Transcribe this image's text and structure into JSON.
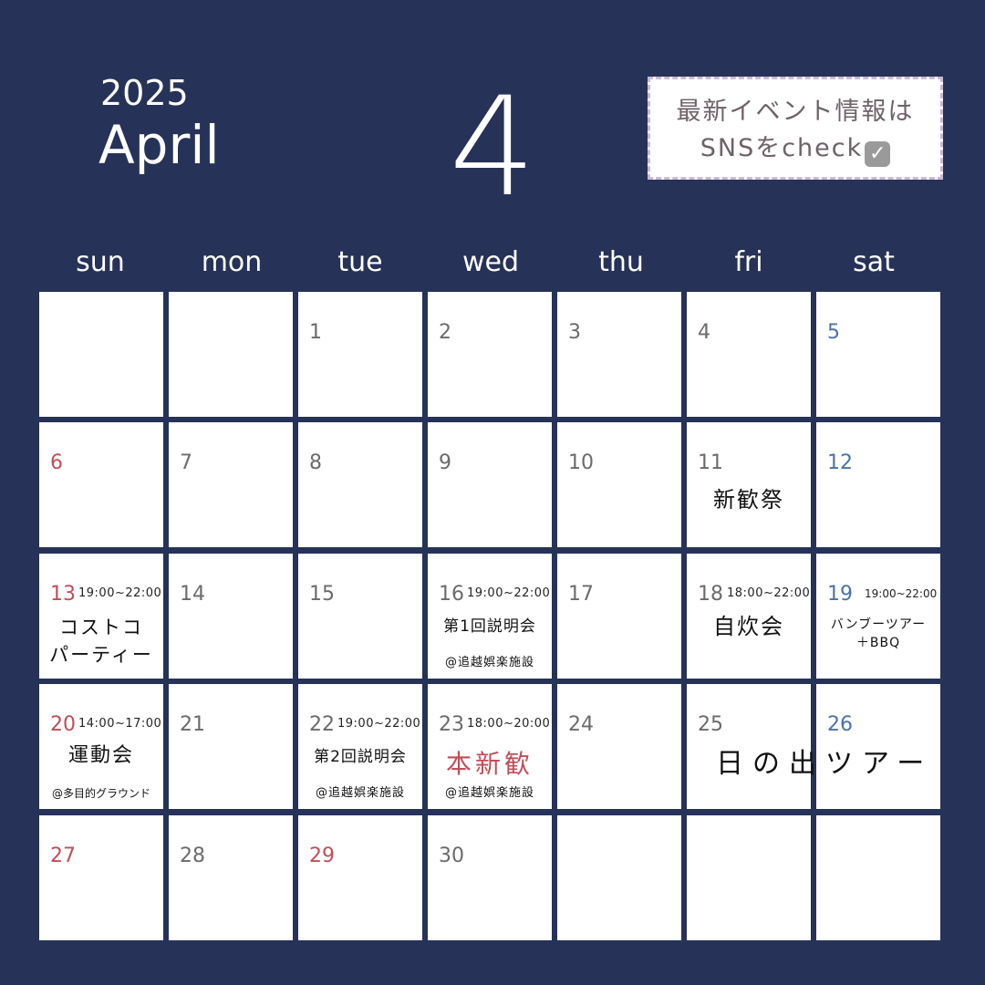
{
  "header": {
    "year": "2025",
    "month_name": "April",
    "month_number": "4",
    "sns_line1": "最新イベント情報は",
    "sns_line2": "SNSをcheck",
    "sns_icon": "checkbox-icon"
  },
  "weekdays": [
    "sun",
    "mon",
    "tue",
    "wed",
    "thu",
    "fri",
    "sat"
  ],
  "days": {
    "d1": "1",
    "d2": "2",
    "d3": "3",
    "d4": "4",
    "d5": "5",
    "d6": "6",
    "d7": "7",
    "d8": "8",
    "d9": "9",
    "d10": "10",
    "d11": "11",
    "d12": "12",
    "d13": "13",
    "d14": "14",
    "d15": "15",
    "d16": "16",
    "d17": "17",
    "d18": "18",
    "d19": "19",
    "d20": "20",
    "d21": "21",
    "d22": "22",
    "d23": "23",
    "d24": "24",
    "d25": "25",
    "d26": "26",
    "d27": "27",
    "d28": "28",
    "d29": "29",
    "d30": "30"
  },
  "events": {
    "e11": {
      "title": "新歓祭"
    },
    "e13": {
      "time": "19:00~22:00",
      "title_line1": "コストコ",
      "title_line2": "パーティー"
    },
    "e16": {
      "time": "19:00~22:00",
      "title": "第1回説明会",
      "location": "@追越娯楽施設"
    },
    "e18": {
      "time": "18:00~22:00",
      "title": "自炊会"
    },
    "e19": {
      "time": "19:00~22:00",
      "title_line1": "バンブーツアー",
      "title_line2": "＋BBQ"
    },
    "e20": {
      "time": "14:00~17:00",
      "title": "運動会",
      "location": "@多目的グラウンド"
    },
    "e22": {
      "time": "19:00~22:00",
      "title": "第2回説明会",
      "location": "@追越娯楽施設"
    },
    "e23": {
      "time": "18:00~20:00",
      "title": "本新歓",
      "location": "@追越娯楽施設"
    },
    "e25": {
      "title": "日の出ツアー"
    }
  },
  "colors": {
    "background": "#263257",
    "sunday_red": "#c04e58",
    "saturday_blue": "#4b72a8",
    "date_gray": "#6b6b6b",
    "highlight_red": "#c04e58"
  }
}
